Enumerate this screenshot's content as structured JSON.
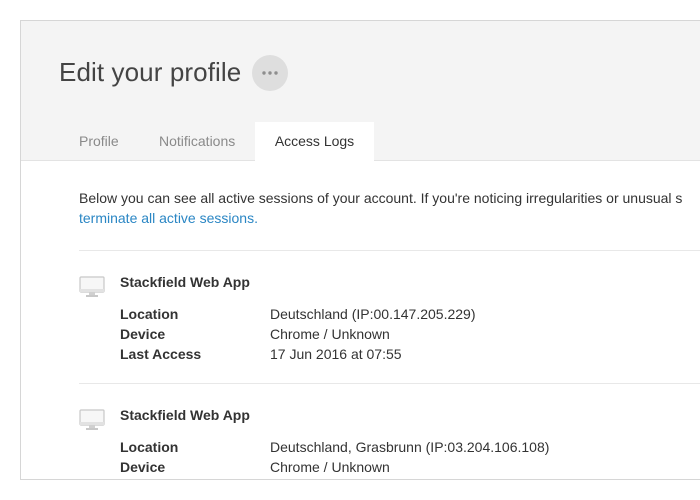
{
  "header": {
    "title": "Edit your profile",
    "more_icon": "ellipsis-icon"
  },
  "tabs": [
    {
      "label": "Profile",
      "active": false
    },
    {
      "label": "Notifications",
      "active": false
    },
    {
      "label": "Access Logs",
      "active": true
    }
  ],
  "intro": {
    "text": "Below you can see all active sessions of your account. If you're noticing irregularities or unusual s",
    "link": "terminate all active sessions."
  },
  "sessions": [
    {
      "icon": "desktop-computer-icon",
      "title": "Stackfield Web App",
      "location_label": "Location",
      "location": "Deutschland (IP:00.147.205.229)",
      "device_label": "Device",
      "device": "Chrome / Unknown",
      "last_access_label": "Last Access",
      "last_access": "17 Jun 2016 at 07:55"
    },
    {
      "icon": "desktop-computer-icon",
      "title": "Stackfield Web App",
      "location_label": "Location",
      "location": "Deutschland, Grasbrunn (IP:03.204.106.108)",
      "device_label": "Device",
      "device": "Chrome / Unknown"
    }
  ],
  "colors": {
    "header_bg": "#f4f4f4",
    "link": "#2a86c4",
    "active_tab_bg": "#ffffff",
    "inactive_tab_text": "#8a8a8a"
  }
}
